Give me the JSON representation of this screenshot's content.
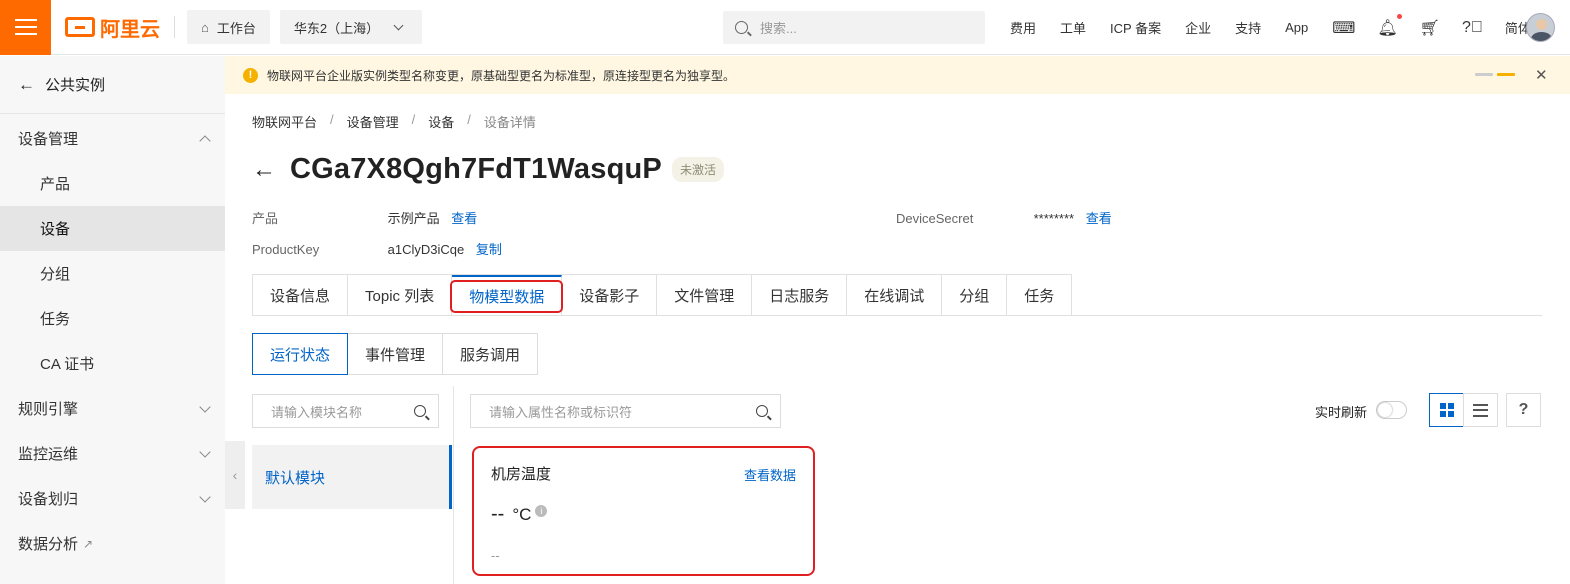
{
  "topbar": {
    "logo_text": "阿里云",
    "workbench": "工作台",
    "region": "华东2（上海）",
    "search_placeholder": "搜索...",
    "links": [
      "费用",
      "工单",
      "ICP 备案",
      "企业",
      "支持",
      "App"
    ],
    "lang": "简体"
  },
  "sidebar": {
    "back_label": "公共实例",
    "device_mgmt": "设备管理",
    "sub_items": [
      "产品",
      "设备",
      "分组",
      "任务",
      "CA 证书"
    ],
    "rules": "规则引擎",
    "monitor": "监控运维",
    "allot": "设备划归",
    "analytics": "数据分析"
  },
  "notice": {
    "text": "物联网平台企业版实例类型名称变更，原基础型更名为标准型，原连接型更名为独享型。"
  },
  "breadcrumb": [
    "物联网平台",
    "设备管理",
    "设备",
    "设备详情"
  ],
  "breadcrumb_sep": "/",
  "device": {
    "name": "CGa7X8Qgh7FdT1WasquP",
    "status": "未激活",
    "product_label": "产品",
    "product_value": "示例产品",
    "view_link": "查看",
    "productkey_label": "ProductKey",
    "productkey_value": "a1ClyD3iCqe",
    "copy_link": "复制",
    "secret_label": "DeviceSecret",
    "secret_value": "********",
    "secret_view": "查看"
  },
  "tabs": [
    "设备信息",
    "Topic 列表",
    "物模型数据",
    "设备影子",
    "文件管理",
    "日志服务",
    "在线调试",
    "分组",
    "任务"
  ],
  "active_tab": "物模型数据",
  "subtabs": [
    "运行状态",
    "事件管理",
    "服务调用"
  ],
  "module_search_placeholder": "请输入模块名称",
  "attr_search_placeholder": "请输入属性名称或标识符",
  "realtime_label": "实时刷新",
  "realtime_on": false,
  "module_name": "默认模块",
  "card": {
    "title": "机房温度",
    "link": "查看数据",
    "value": "--",
    "unit": "°C",
    "time": "--"
  },
  "colors": {
    "brand": "#ff6a00",
    "accent": "#0064c8",
    "highlight": "#e02020"
  }
}
